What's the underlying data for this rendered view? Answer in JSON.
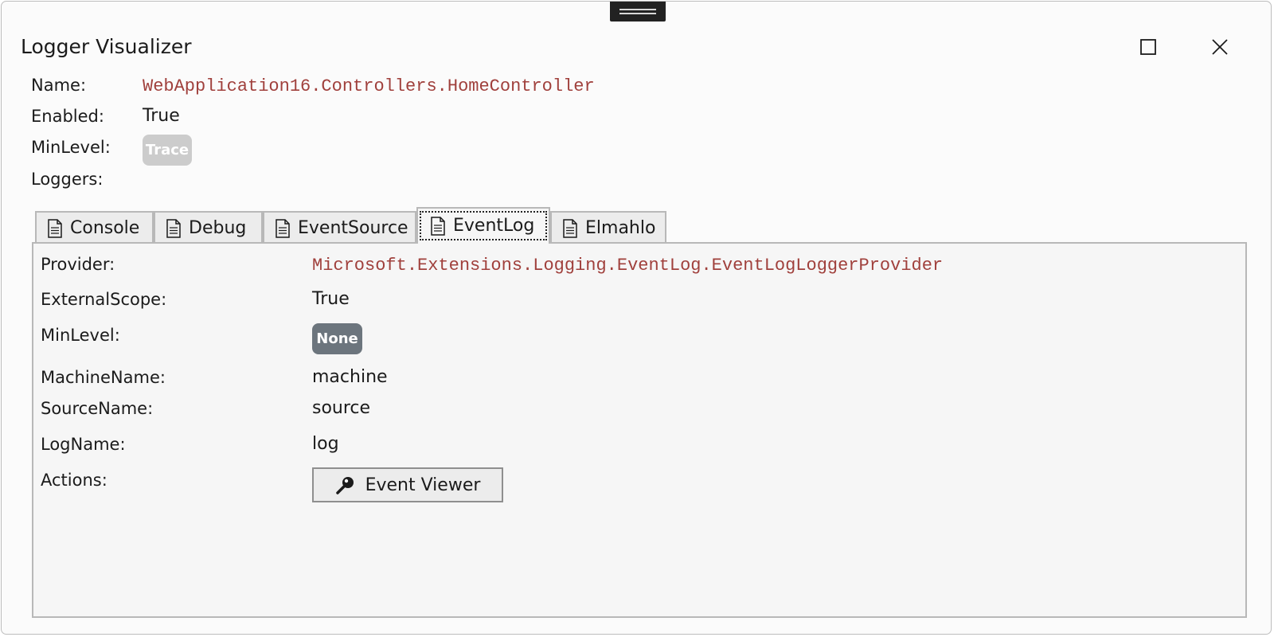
{
  "window": {
    "title": "Logger Visualizer",
    "icons": {
      "maximize": "maximize-icon",
      "close": "close-icon",
      "grip": "drag-grip-icon"
    }
  },
  "logger": {
    "name_label": "Name:",
    "name_value": "WebApplication16.Controllers.HomeController",
    "enabled_label": "Enabled:",
    "enabled_value": "True",
    "minlevel_label": "MinLevel:",
    "minlevel_value": "Trace",
    "minlevel_color": "#cccccc",
    "loggers_label": "Loggers:"
  },
  "tabs": [
    {
      "label": "Console",
      "icon": "document-icon",
      "active": false
    },
    {
      "label": "Debug",
      "icon": "document-icon",
      "active": false
    },
    {
      "label": "EventSource",
      "icon": "document-icon",
      "active": false
    },
    {
      "label": "EventLog",
      "icon": "document-icon",
      "active": true
    },
    {
      "label": "Elmahlo",
      "icon": "document-icon",
      "active": false
    }
  ],
  "eventlog": {
    "provider_label": "Provider:",
    "provider_value": "Microsoft.Extensions.Logging.EventLog.EventLogLoggerProvider",
    "externalscope_label": "ExternalScope:",
    "externalscope_value": "True",
    "minlevel_label": "MinLevel:",
    "minlevel_value": "None",
    "minlevel_color": "#6c757d",
    "machinename_label": "MachineName:",
    "machinename_value": "machine",
    "sourcename_label": "SourceName:",
    "sourcename_value": "source",
    "logname_label": "LogName:",
    "logname_value": "log",
    "actions_label": "Actions:",
    "event_viewer_button": "Event Viewer",
    "event_viewer_icon": "search-icon"
  },
  "colors": {
    "monospace_value": "#a0403c",
    "panel_bg": "#f6f6f6",
    "border": "#b8b8b8"
  }
}
